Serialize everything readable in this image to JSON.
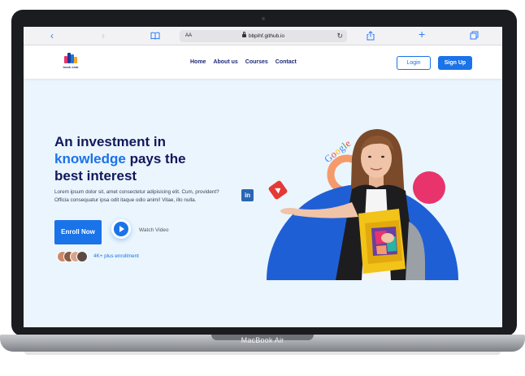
{
  "device": {
    "label": "MacBook Air"
  },
  "browser": {
    "reader_label": "AA",
    "url": "bbpihf.github.io",
    "icons": [
      "back-icon",
      "forward-icon",
      "book-icon",
      "lock-icon",
      "reload-icon",
      "share-icon",
      "new-tab-icon",
      "tabs-icon"
    ]
  },
  "nav": {
    "logo_text": "book club",
    "links": [
      "Home",
      "About us",
      "Courses",
      "Contact"
    ],
    "login_label": "Login",
    "signup_label": "Sign Up"
  },
  "hero": {
    "title_line1": "An investment in",
    "title_accent": "knowledge",
    "title_line2_rest": " pays the",
    "title_line3": "best interest",
    "description": "Lorem ipsum dolor sit, amet consectetur adipisicing elit. Cum, provident? Officia consequatur ipsa odit itaque odio animi! Vitae, illo nulla.",
    "enroll_label": "Enroll Now",
    "watch_label": "Watch Video",
    "enrollment_text": "4K+ plus enrollment"
  },
  "illustration": {
    "google_text": "Google",
    "linkedin_text": "in"
  },
  "colors": {
    "accent": "#1a73e8",
    "title": "#12185c",
    "hero_bg": "#eaf5fd",
    "blob_blue": "#1f5fd6",
    "blob_pink": "#e8336c",
    "blob_orange": "#f59a6b"
  }
}
